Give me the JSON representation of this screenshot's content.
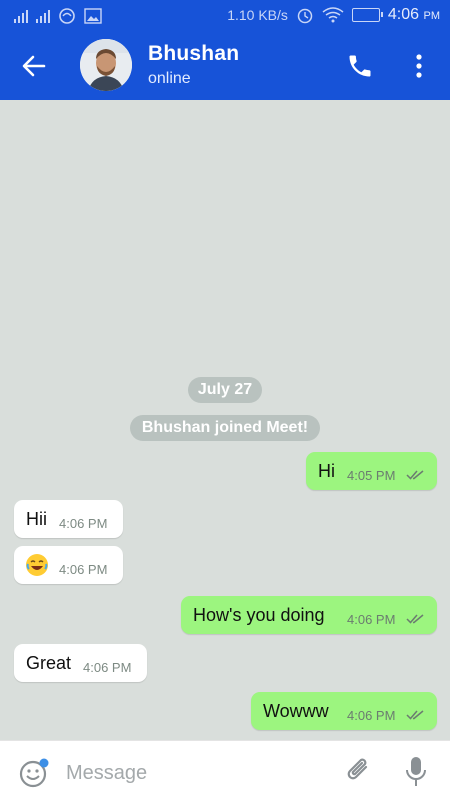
{
  "status_bar": {
    "speed": "1.10 KB/s",
    "time": "4:06",
    "ampm": "PM"
  },
  "header": {
    "contact_name": "Bhushan",
    "contact_status": "online"
  },
  "chat": {
    "date_label": "July 27",
    "system_message": "Bhushan joined Meet!",
    "messages": [
      {
        "direction": "outgoing",
        "text": "Hi",
        "time": "4:05 PM",
        "ticks": "double-check-icon"
      },
      {
        "direction": "incoming",
        "text": "Hii",
        "time": "4:06 PM"
      },
      {
        "direction": "incoming",
        "text": "",
        "emoji": "laughing-tears-emoji",
        "time": "4:06 PM"
      },
      {
        "direction": "outgoing",
        "text": "How's you doing",
        "time": "4:06 PM",
        "ticks": "double-check-icon"
      },
      {
        "direction": "incoming",
        "text": "Great",
        "time": "4:06 PM"
      },
      {
        "direction": "outgoing",
        "text": "Wowww",
        "time": "4:06 PM",
        "ticks": "double-check-icon"
      }
    ]
  },
  "composer": {
    "placeholder": "Message"
  },
  "colors": {
    "primary": "#1753d8",
    "outgoing_bubble": "#9cf57f",
    "incoming_bubble": "#ffffff",
    "chat_background": "#d9dedb"
  }
}
